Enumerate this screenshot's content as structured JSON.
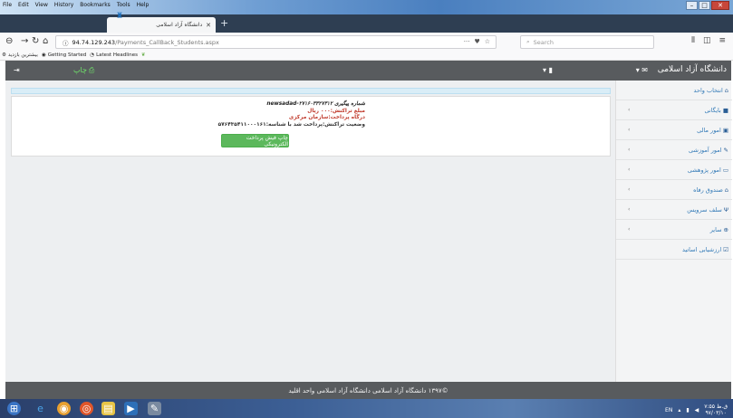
{
  "browser": {
    "menu": [
      "File",
      "Edit",
      "View",
      "History",
      "Bookmarks",
      "Tools",
      "Help"
    ],
    "tab_title": "دانشگاه آزاد اسلامی",
    "url_host": "94.74.129.243",
    "url_path": "/Payments_CallBack_Students.aspx",
    "search_placeholder": "Search",
    "bookmarks": [
      "بیشترین بازدید",
      "Getting Started",
      "Latest Headlines"
    ]
  },
  "header": {
    "brand": "دانشگاه آزاد اسلامی",
    "print_label": "چاپ"
  },
  "receipt": {
    "tracking": "شماره پیگیری ۲۷۱۶۰۳۳۲۷۳۱۲-newsadad",
    "amount": "مبلغ تراکنش:۰۰۰ ریال",
    "gateway": "درگاه پرداخت:سازمان مرکزی",
    "status": "وضعیت تراکنش:پرداخت شد با شناسه:۵۷۶۴۳۵۴۱۱۰۰۰۱۶۱",
    "print_button": "چاپ فیش پرداخت الکترونیکی"
  },
  "sidebar": {
    "items": [
      {
        "label": "انتخاب واحد",
        "icon": "home-icon",
        "has_children": false
      },
      {
        "label": "بایگانی",
        "icon": "archive-icon",
        "has_children": true
      },
      {
        "label": "امور مالی",
        "icon": "money-icon",
        "has_children": true
      },
      {
        "label": "امور آموزشی",
        "icon": "pencil-icon",
        "has_children": true
      },
      {
        "label": "امور پژوهشی",
        "icon": "monitor-icon",
        "has_children": true
      },
      {
        "label": "صندوق رفاه",
        "icon": "bank-icon",
        "has_children": true
      },
      {
        "label": "سلف سرویس",
        "icon": "food-icon",
        "has_children": true
      },
      {
        "label": "سایر",
        "icon": "plus-circle-icon",
        "has_children": true
      },
      {
        "label": "ارزشیابی اساتید",
        "icon": "checkbox-icon",
        "has_children": false
      }
    ]
  },
  "footer": {
    "text": "©۱۳۹۷ دانشگاه آزاد اسلامی دانشگاه آزاد اسلامی واحد اقلید"
  },
  "taskbar": {
    "lang": "EN",
    "time": "۷:۵۵ ق.ظ",
    "date": "۹۷/۰۳/۱۰"
  }
}
